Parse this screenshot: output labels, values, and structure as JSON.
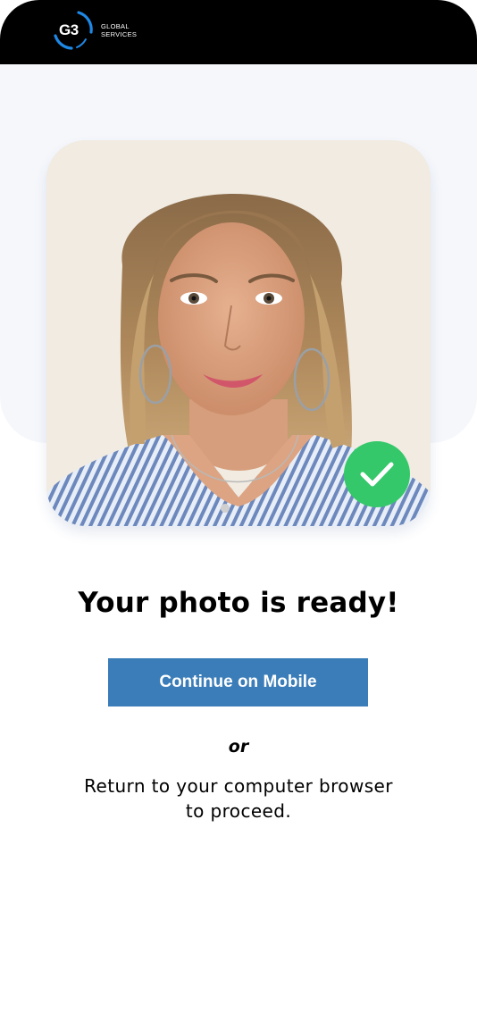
{
  "header": {
    "logo_mark_text": "G3",
    "logo_text_line1": "GLOBAL",
    "logo_text_line2": "SERVICES"
  },
  "photo": {
    "status_icon": "checkmark-icon",
    "status_color": "#34c86a"
  },
  "main": {
    "title": "Your photo is ready!",
    "continue_button_label": "Continue on Mobile",
    "or_label": "or",
    "return_message": "Return to your computer browser to proceed."
  },
  "colors": {
    "header_bg": "#000000",
    "panel_bg": "#f5f7fb",
    "button_bg": "#3b7db8",
    "accent_blue": "#1e88e5"
  }
}
